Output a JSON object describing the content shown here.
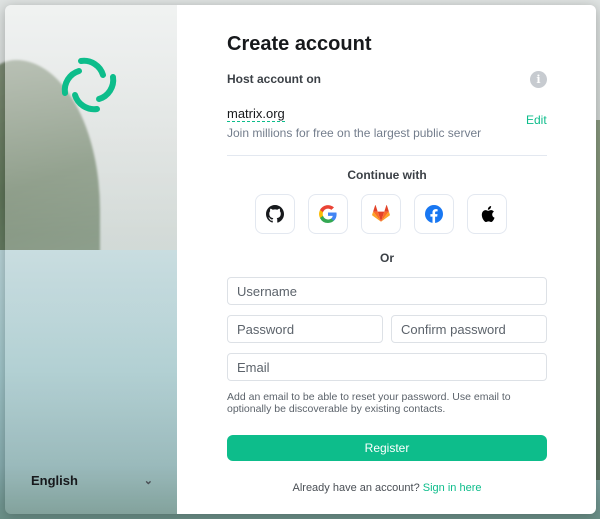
{
  "header": {
    "title": "Create account"
  },
  "host": {
    "label": "Host account on",
    "server": "matrix.org",
    "description": "Join millions for free on the largest public server",
    "edit_label": "Edit"
  },
  "sso": {
    "label": "Continue with",
    "providers": [
      "github-icon",
      "google-icon",
      "gitlab-icon",
      "facebook-icon",
      "apple-icon"
    ]
  },
  "divider_text": "Or",
  "form": {
    "username_placeholder": "Username",
    "password_placeholder": "Password",
    "confirm_placeholder": "Confirm password",
    "email_placeholder": "Email",
    "email_hint": "Add an email to be able to reset your password. Use email to optionally be discoverable by existing contacts.",
    "register_label": "Register"
  },
  "footer": {
    "prompt": "Already have an account?",
    "signin_label": "Sign in here"
  },
  "language": {
    "selected": "English"
  },
  "colors": {
    "accent": "#0dbd8b",
    "text": "#17191c",
    "muted": "#737d8c"
  }
}
